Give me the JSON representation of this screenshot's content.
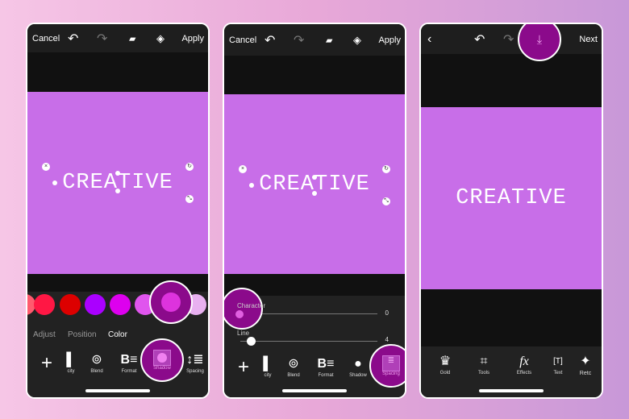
{
  "screens": [
    {
      "header": {
        "cancel": "Cancel",
        "apply": "Apply"
      },
      "canvas_text": "CREATIVE",
      "swatches": [
        "#ff5a6e",
        "#ff1744",
        "#dd0000",
        "#aa00ff",
        "#dd00ee",
        "#e055ee",
        "#dd33dd",
        "#e8b0f0"
      ],
      "tabs": [
        "Adjust",
        "Position",
        "Color"
      ],
      "active_tab": "Color",
      "tools": [
        "city",
        "Blend",
        "Format",
        "Shadow",
        "Spacing"
      ],
      "active_tool": "Shadow"
    },
    {
      "header": {
        "cancel": "Cancel",
        "apply": "Apply"
      },
      "canvas_text": "CREATIVE",
      "sliders": [
        {
          "label": "Character",
          "value": "0",
          "level": 0
        },
        {
          "label": "Line",
          "value": "4",
          "level": 0.08
        }
      ],
      "tools": [
        "city",
        "Blend",
        "Format",
        "Shadow",
        "Spacing"
      ],
      "active_tool": "Spacing"
    },
    {
      "header": {
        "next": "Next"
      },
      "canvas_text": "CREATIVE",
      "tools": [
        "Gold",
        "Tools",
        "Effects",
        "Text",
        "Retc"
      ]
    }
  ],
  "colors": {
    "accent": "#8b0a8b",
    "canvas": "#c86ee8"
  }
}
